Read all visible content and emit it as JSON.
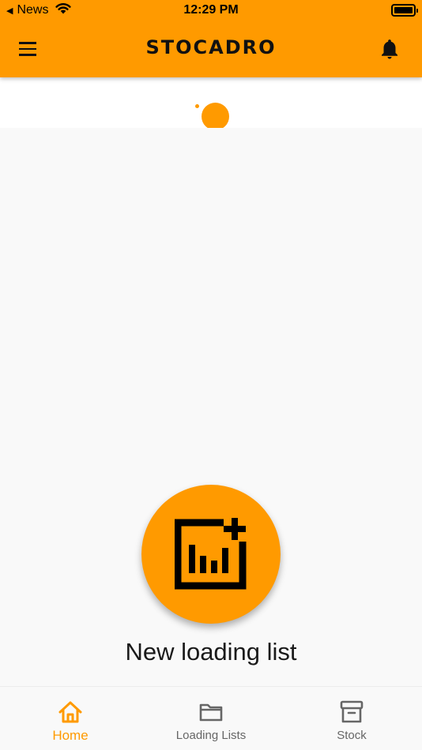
{
  "status_bar": {
    "back_app": "News",
    "time": "12:29 PM"
  },
  "header": {
    "brand": "STOCADRO",
    "menu_icon": "hamburger-menu-icon",
    "notification_icon": "bell-icon"
  },
  "main": {
    "action_icon": "loading-list-add-icon",
    "action_label": "New loading list"
  },
  "bottom_nav": {
    "items": [
      {
        "label": "Home",
        "icon": "home-icon",
        "active": true
      },
      {
        "label": "Loading Lists",
        "icon": "folder-icon",
        "active": false
      },
      {
        "label": "Stock",
        "icon": "archive-box-icon",
        "active": false
      }
    ]
  },
  "colors": {
    "accent": "#ff9a00",
    "background": "#f9f9f9",
    "inactive": "#666666"
  }
}
